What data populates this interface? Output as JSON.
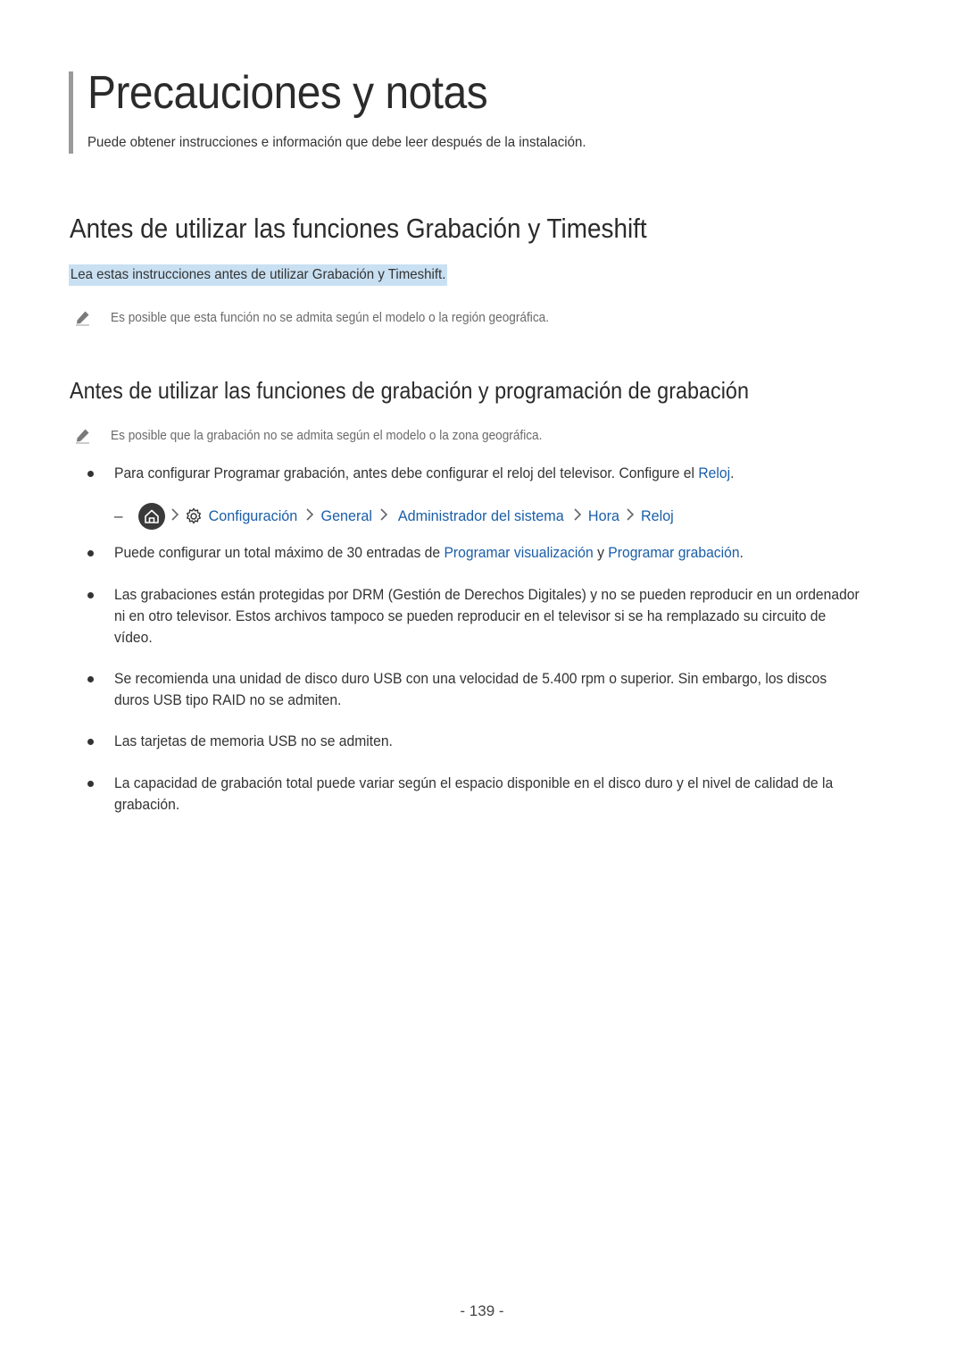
{
  "page": {
    "title": "Precauciones y notas",
    "subtitle": "Puede obtener instrucciones e información que debe leer después de la instalación.",
    "page_number": "- 139 -"
  },
  "section1": {
    "heading": "Antes de utilizar las funciones Grabación y Timeshift",
    "intro": "Lea estas instrucciones antes de utilizar Grabación y Timeshift.",
    "note": "Es posible que esta función no se admita según el modelo o la región geográfica.",
    "note_icon": "pencil-icon"
  },
  "section2": {
    "heading": "Antes de utilizar las funciones de grabación y programación de grabación",
    "note": "Es posible que la grabación no se admita según el modelo o la zona geográfica.",
    "bullets": [
      {
        "text_before": "Para configurar Programar grabación, antes debe configurar el reloj del televisor. Configure el ",
        "link": "Reloj",
        "text_after": "."
      },
      {
        "text_before": "Puede configurar un total máximo de 30 entradas de ",
        "link1": "Programar visualización",
        "text_middle": " y ",
        "link2": "Programar grabación",
        "text_after": "."
      },
      {
        "text": "Las grabaciones están protegidas por DRM (Gestión de Derechos Digitales) y no se pueden reproducir en un ordenador ni en otro televisor. Estos archivos tampoco se pueden reproducir en el televisor si se ha remplazado su circuito de vídeo."
      },
      {
        "text": "Se recomienda una unidad de disco duro USB con una velocidad de 5.400 rpm o superior. Sin embargo, los discos duros USB tipo RAID no se admiten."
      },
      {
        "text": "Las tarjetas de memoria USB no se admiten."
      },
      {
        "text": "La capacidad de grabación total puede variar según el espacio disponible en el disco duro y el nivel de calidad de la grabación."
      }
    ],
    "menu_path": {
      "dash": "–",
      "home_icon": "home-icon",
      "settings_icon": "gear-icon",
      "items": [
        "Configuración",
        "General",
        "Administrador del sistema",
        "Hora",
        "Reloj"
      ]
    }
  },
  "colors": {
    "link": "#1a5ea8",
    "highlight": "#c9e0f2",
    "title_bar": "#9a9a9a",
    "note_text": "#6a6a6a"
  }
}
